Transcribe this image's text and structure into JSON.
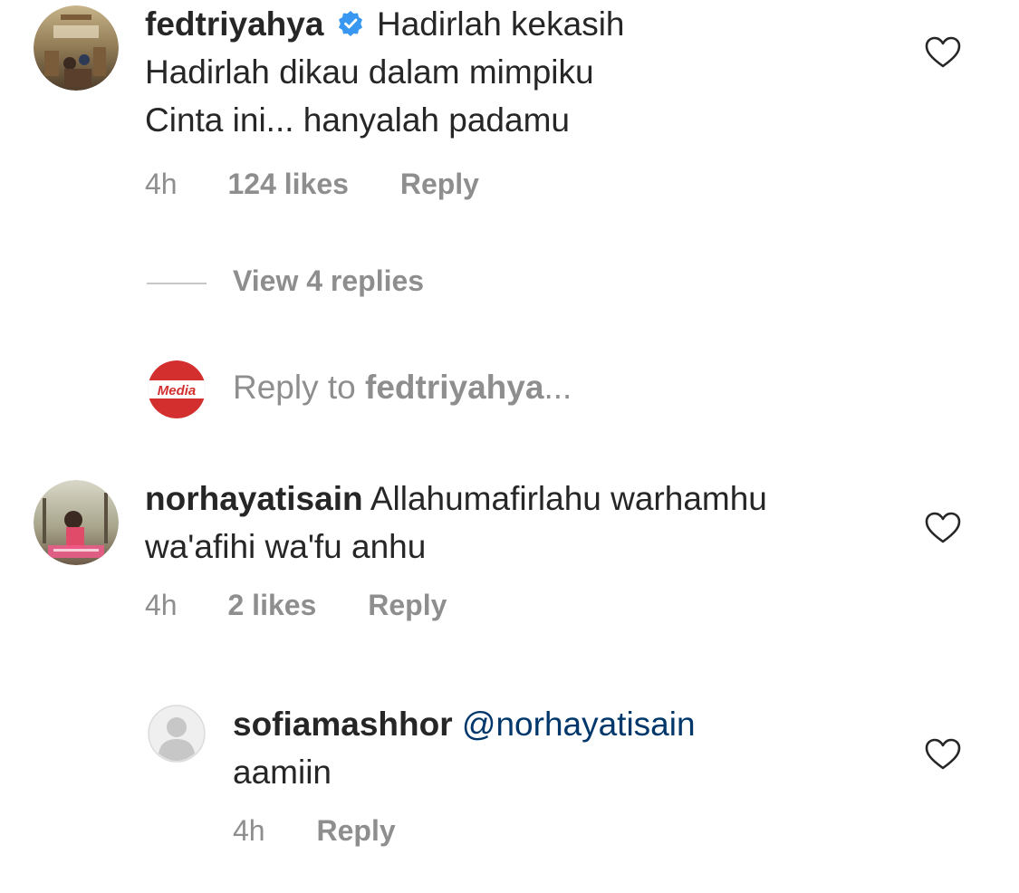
{
  "comments": [
    {
      "username": "fedtriyahya",
      "verified": true,
      "lines": [
        "Hadirlah kekasih",
        "Hadirlah dikau dalam mimpiku",
        "Cinta ini... hanyalah padamu"
      ],
      "time": "4h",
      "likes": "124 likes",
      "reply_label": "Reply",
      "view_replies": "View 4 replies"
    },
    {
      "username": "norhayatisain",
      "lines": [
        "Allahumafirlahu warhamhu",
        "wa'afihi wa'fu anhu"
      ],
      "time": "4h",
      "likes": "2 likes",
      "reply_label": "Reply"
    }
  ],
  "reply_box": {
    "prefix": "Reply to ",
    "username": "fedtriyahya",
    "suffix": "...",
    "avatar_text": "Media"
  },
  "reply": {
    "username": "sofiamashhor",
    "mention": "@norhayatisain",
    "lines": [
      "aamiin"
    ],
    "time": "4h",
    "reply_label": "Reply"
  },
  "colors": {
    "text": "#262626",
    "secondary": "#8e8e8e",
    "mention": "#00376b",
    "verified": "#3897f0",
    "media_red": "#d32f2f"
  },
  "icons": {
    "like": "heart-outline-icon",
    "verified": "verified-badge-icon"
  }
}
